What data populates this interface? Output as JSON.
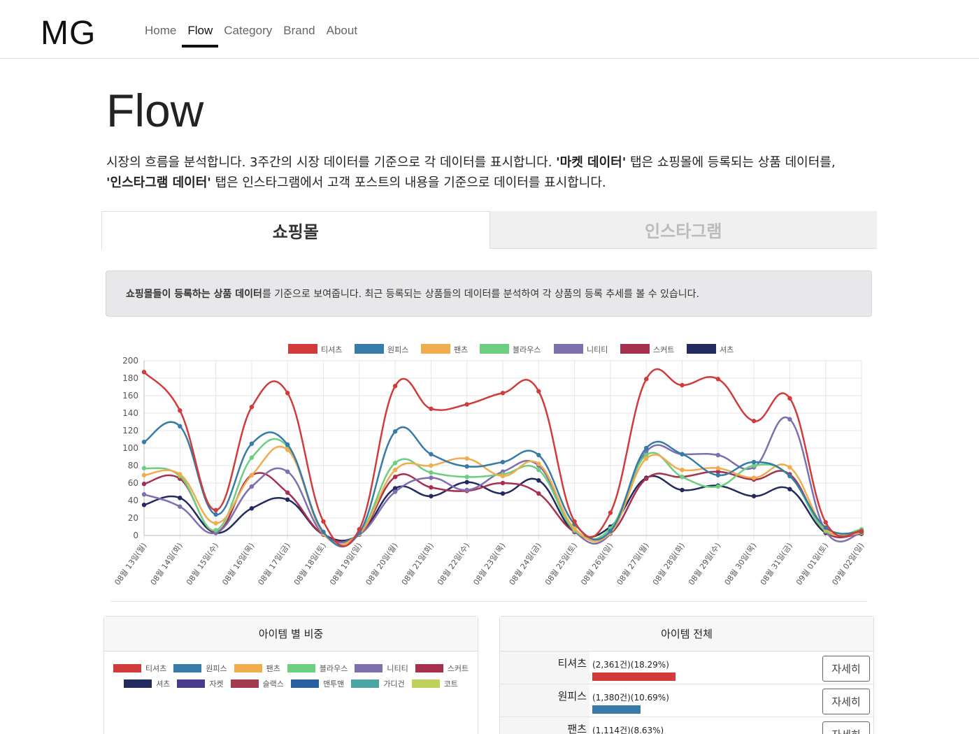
{
  "nav": {
    "brand": "MG",
    "items": [
      "Home",
      "Flow",
      "Category",
      "Brand",
      "About"
    ],
    "active": "Flow"
  },
  "page": {
    "title": "Flow",
    "intro_1": "시장의 흐름을 분석합니다. 3주간의 시장 데이터를 기준으로 각 데이터를 표시합니다. ",
    "intro_b1": "'마켓 데이터'",
    "intro_2": " 탭은 쇼핑몰에 등록되는 상품 데이터를,",
    "intro_b2": "'인스타그램 데이터'",
    "intro_3": " 탭은 인스타그램에서 고객 포스트의 내용을 기준으로 데이터를 표시합니다."
  },
  "tabs": [
    {
      "label": "쇼핑몰",
      "active": true
    },
    {
      "label": "인스타그램",
      "active": false
    }
  ],
  "notice": {
    "bold": "쇼핑몰들이 등록하는 상품 데이터",
    "rest": "를 기준으로 보여줍니다. 최근 등록되는 상품들의 데이터를 분석하여 각 상품의 등록 추세를 볼 수 있습니다."
  },
  "chart_data": {
    "type": "line",
    "categories": [
      "08월 13일(월)",
      "08월 14일(화)",
      "08월 15일(수)",
      "08월 16일(목)",
      "08월 17일(금)",
      "08월 18일(토)",
      "08월 19일(일)",
      "08월 20일(월)",
      "08월 21일(화)",
      "08월 22일(수)",
      "08월 23일(목)",
      "08월 24일(금)",
      "08월 25일(토)",
      "08월 26일(일)",
      "08월 27일(월)",
      "08월 28일(화)",
      "08월 29일(수)",
      "08월 30일(목)",
      "08월 31일(금)",
      "09월 01일(토)",
      "09월 02일(일)"
    ],
    "ylim": [
      0,
      200
    ],
    "yticks": [
      0,
      20,
      40,
      60,
      80,
      100,
      120,
      140,
      160,
      180,
      200
    ],
    "grid": true,
    "legend": "top",
    "series": [
      {
        "name": "티셔츠",
        "color": "#d13b3b",
        "values": [
          187,
          143,
          29,
          147,
          163,
          16,
          7,
          171,
          145,
          150,
          163,
          165,
          16,
          26,
          179,
          172,
          179,
          131,
          157,
          15,
          5
        ]
      },
      {
        "name": "원피스",
        "color": "#377ba8",
        "values": [
          107,
          125,
          24,
          105,
          104,
          4,
          3,
          119,
          93,
          79,
          84,
          92,
          13,
          5,
          100,
          93,
          69,
          84,
          68,
          9,
          4
        ]
      },
      {
        "name": "팬츠",
        "color": "#f0ad4e",
        "values": [
          69,
          70,
          14,
          69,
          98,
          2,
          2,
          75,
          80,
          88,
          68,
          82,
          8,
          3,
          88,
          75,
          77,
          66,
          78,
          7,
          3
        ]
      },
      {
        "name": "블라우스",
        "color": "#6ccf7f",
        "values": [
          77,
          68,
          6,
          89,
          102,
          3,
          3,
          83,
          72,
          67,
          70,
          75,
          6,
          8,
          92,
          67,
          56,
          80,
          68,
          5,
          7
        ]
      },
      {
        "name": "니티티",
        "color": "#7e6fae",
        "values": [
          47,
          33,
          3,
          56,
          73,
          1,
          1,
          50,
          66,
          52,
          73,
          80,
          5,
          2,
          96,
          93,
          92,
          78,
          133,
          5,
          3
        ]
      },
      {
        "name": "스커트",
        "color": "#a8304f",
        "values": [
          59,
          65,
          4,
          69,
          49,
          1,
          1,
          67,
          55,
          51,
          60,
          48,
          4,
          2,
          65,
          67,
          73,
          64,
          70,
          4,
          3
        ]
      },
      {
        "name": "셔츠",
        "color": "#232a5e",
        "values": [
          35,
          43,
          3,
          31,
          41,
          1,
          1,
          54,
          45,
          61,
          48,
          63,
          4,
          10,
          66,
          52,
          57,
          45,
          53,
          3,
          2
        ]
      }
    ]
  },
  "share_card": {
    "title": "아이템 별 비중",
    "legend": [
      {
        "name": "티셔츠",
        "color": "#d13b3b"
      },
      {
        "name": "원피스",
        "color": "#377ba8"
      },
      {
        "name": "팬츠",
        "color": "#f0ad4e"
      },
      {
        "name": "블라우스",
        "color": "#6ccf7f"
      },
      {
        "name": "니티티",
        "color": "#7e6fae"
      },
      {
        "name": "스커트",
        "color": "#a8304f"
      },
      {
        "name": "셔츠",
        "color": "#232a5e"
      },
      {
        "name": "자켓",
        "color": "#4b3b8f"
      },
      {
        "name": "슬랙스",
        "color": "#a33a4e"
      },
      {
        "name": "맨투맨",
        "color": "#2a5fa0"
      },
      {
        "name": "가디건",
        "color": "#4ba5a5"
      },
      {
        "name": "코트",
        "color": "#bfd15a"
      }
    ]
  },
  "all_card": {
    "title": "아이템 전체",
    "button_label": "자세히",
    "items": [
      {
        "name": "티셔츠",
        "stat": "(2,361건)(18.29%)",
        "share": 18.29,
        "color": "#d13b3b"
      },
      {
        "name": "원피스",
        "stat": "(1,380건)(10.69%)",
        "share": 10.69,
        "color": "#377ba8"
      },
      {
        "name": "팬츠",
        "stat": "(1,114건)(8.63%)",
        "share": 8.63,
        "color": "#f0ad4e"
      }
    ]
  }
}
